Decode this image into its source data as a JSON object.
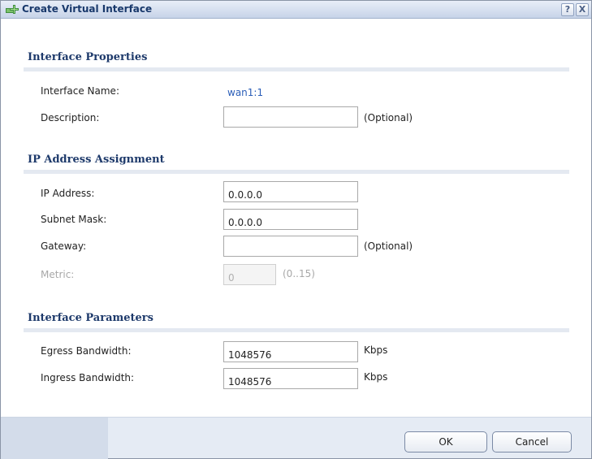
{
  "dialog": {
    "title": "Create Virtual Interface",
    "help_label": "?",
    "close_label": "X"
  },
  "interface_properties": {
    "heading": "Interface Properties",
    "name_label": "Interface Name:",
    "name_value": "wan1:1",
    "description_label": "Description:",
    "description_value": "",
    "description_hint": "(Optional)"
  },
  "ip_assignment": {
    "heading": "IP Address Assignment",
    "ip_label": "IP Address:",
    "ip_value": "0.0.0.0",
    "subnet_label": "Subnet Mask:",
    "subnet_value": "0.0.0.0",
    "gateway_label": "Gateway:",
    "gateway_value": "",
    "gateway_hint": "(Optional)",
    "metric_label": "Metric:",
    "metric_value": "0",
    "metric_hint": "(0..15)"
  },
  "interface_parameters": {
    "heading": "Interface Parameters",
    "egress_label": "Egress Bandwidth:",
    "egress_value": "1048576",
    "egress_unit": "Kbps",
    "ingress_label": "Ingress Bandwidth:",
    "ingress_value": "1048576",
    "ingress_unit": "Kbps"
  },
  "footer": {
    "ok_label": "OK",
    "cancel_label": "Cancel"
  },
  "icons": {
    "title_icon": "add-interface-icon"
  },
  "colors": {
    "title_text": "#18386b",
    "section_heading": "#1e3a6b",
    "link_value": "#2b5eb8",
    "footer_bg": "#e5ebf4"
  }
}
